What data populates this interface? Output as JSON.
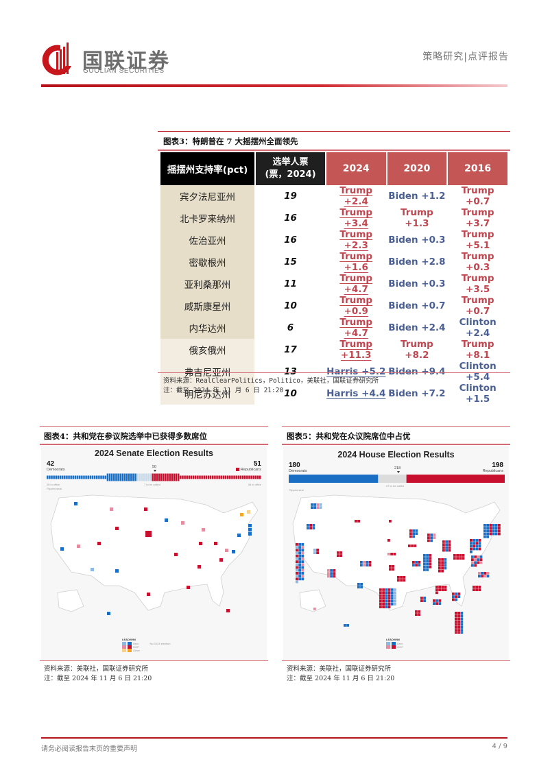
{
  "header": {
    "brand_cn": "国联证券",
    "brand_en": "GUOLIAN SECURITIES",
    "report_type": "策略研究|点评报告",
    "logo_icon": "guolian-logo-icon"
  },
  "figure3": {
    "title": "图表3：特朗普在 7 大摇摆州全面领先",
    "columns": {
      "state": "摇摆州支持率(pct)",
      "votes_line1": "选举人票",
      "votes_line2": "(票，2024)",
      "y2024": "2024",
      "y2020": "2020",
      "y2016": "2016"
    },
    "rows": [
      {
        "state": "宾夕法尼亚州",
        "votes": "19",
        "y2024": "Trump +2.4",
        "y2020": "Biden +1.2",
        "y2016": "Trump +0.7",
        "p2024": "rep",
        "p2020": "dem",
        "p2016": "rep",
        "group": "g1"
      },
      {
        "state": "北卡罗来纳州",
        "votes": "16",
        "y2024": "Trump +3.4",
        "y2020": "Trump +1.3",
        "y2016": "Trump +3.7",
        "p2024": "rep",
        "p2020": "rep",
        "p2016": "rep",
        "group": "g1"
      },
      {
        "state": "佐治亚州",
        "votes": "16",
        "y2024": "Trump +2.3",
        "y2020": "Biden +0.3",
        "y2016": "Trump +5.1",
        "p2024": "rep",
        "p2020": "dem",
        "p2016": "rep",
        "group": "g1"
      },
      {
        "state": "密歇根州",
        "votes": "15",
        "y2024": "Trump +1.6",
        "y2020": "Biden +2.8",
        "y2016": "Trump +0.3",
        "p2024": "rep",
        "p2020": "dem",
        "p2016": "rep",
        "group": "g1"
      },
      {
        "state": "亚利桑那州",
        "votes": "11",
        "y2024": "Trump +4.7",
        "y2020": "Biden +0.3",
        "y2016": "Trump +3.5",
        "p2024": "rep",
        "p2020": "dem",
        "p2016": "rep",
        "group": "g1"
      },
      {
        "state": "威斯康星州",
        "votes": "10",
        "y2024": "Trump +0.9",
        "y2020": "Biden +0.7",
        "y2016": "Trump +0.7",
        "p2024": "rep",
        "p2020": "dem",
        "p2016": "rep",
        "group": "g1"
      },
      {
        "state": "内华达州",
        "votes": "6",
        "y2024": "Trump +4.7",
        "y2020": "Biden +2.4",
        "y2016": "Clinton +2.4",
        "p2024": "rep",
        "p2020": "dem",
        "p2016": "dem",
        "group": "g1"
      },
      {
        "state": "俄亥俄州",
        "votes": "17",
        "y2024": "Trump +11.3",
        "y2020": "Trump +8.2",
        "y2016": "Trump +8.1",
        "p2024": "rep",
        "p2020": "rep",
        "p2016": "rep",
        "group": "g2"
      },
      {
        "state": "弗吉尼亚州",
        "votes": "13",
        "y2024": "Harris +5.2",
        "y2020": "Biden +9.4",
        "y2016": "Clinton +5.4",
        "p2024": "dem",
        "p2020": "dem",
        "p2016": "dem",
        "group": "g2"
      },
      {
        "state": "明尼苏达州",
        "votes": "10",
        "y2024": "Harris +4.4",
        "y2020": "Biden +7.2",
        "y2016": "Clinton +1.5",
        "p2024": "dem",
        "p2020": "dem",
        "p2016": "dem",
        "group": "g2"
      }
    ],
    "source": "资料来源：RealClearPolitics，Politico，美联社，国联证券研究所",
    "note": "注：截至 2024 年 11 月 6 日 21:20"
  },
  "figure4": {
    "title": "图表4：共和党在参议院选举中已获得多数席位",
    "chart_title": "2024 Senate Election Results",
    "dem_count": "42",
    "dem_label": "Democrats",
    "rep_count": "51",
    "rep_label": "Republicans",
    "majority_mark": "50",
    "dem_in_office": "28 in office",
    "rep_in_office": "38 in office",
    "to_be_called": "7 to be called",
    "flipped_note": "Flipped seat",
    "legend_title": "LEAD/WIN",
    "legend_items": [
      "Dem",
      "GOP",
      "Other"
    ],
    "legend_no_election": "No 2024 election",
    "source": "资料来源：美联社，国联证券研究所",
    "note": "注：截至 2024 年 11 月 6 日 21:20"
  },
  "figure5": {
    "title": "图表5：共和党在众议院席位中占优",
    "chart_title": "2024 House Election Results",
    "dem_count": "180",
    "dem_label": "Democrats",
    "rep_count": "198",
    "rep_label": "Republicans",
    "majority_mark": "218",
    "to_be_called": "57 to be called",
    "flipped_note": "Flipped seat",
    "legend_title": "LEAD/WIN",
    "legend_items": [
      "Dem",
      "GOP"
    ],
    "source": "资料来源：美联社，国联证券研究所",
    "note": "注：截至 2024 年 11 月 6 日 21:20"
  },
  "colors": {
    "brand_red": "#b5121b",
    "table_year_header": "#c55656",
    "rep_text": "#c0464f",
    "dem_text": "#4a5f93",
    "map_dem": "#1a6fc4",
    "map_rep": "#c8102e",
    "map_dem_light": "#8db8e4",
    "map_rep_light": "#e48da0",
    "map_other": "#f5a623"
  },
  "footer": {
    "disclaimer": "请务必阅读报告末页的重要声明",
    "page": "4 / 9"
  }
}
